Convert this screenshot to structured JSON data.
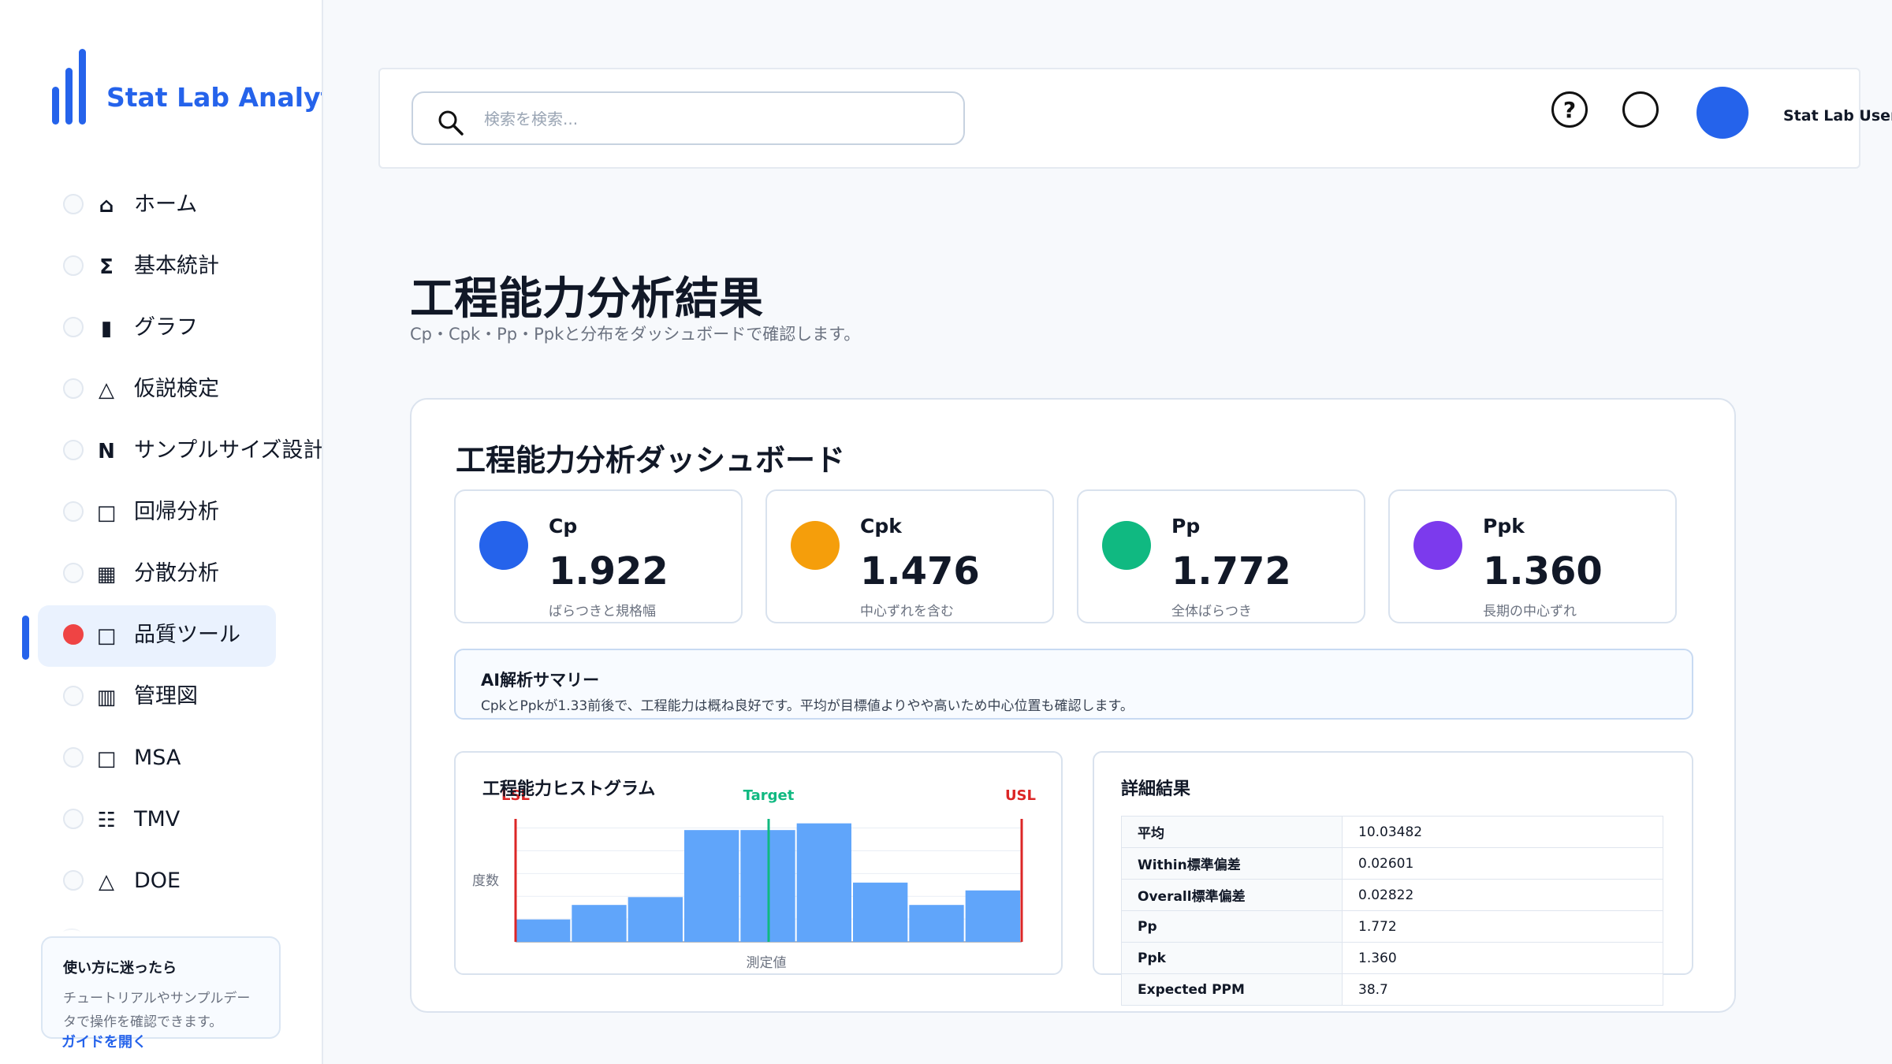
{
  "app": {
    "name": "Stat Lab Analytics"
  },
  "sidebar": {
    "items": [
      {
        "glyph": "⌂",
        "label": "ホーム",
        "icon": "home-icon",
        "active": false
      },
      {
        "glyph": "Σ",
        "label": "基本統計",
        "icon": "sigma-icon",
        "active": false
      },
      {
        "glyph": "▮",
        "label": "グラフ",
        "icon": "bar-icon",
        "active": false
      },
      {
        "glyph": "△",
        "label": "仮説検定",
        "icon": "triangle-icon",
        "active": false
      },
      {
        "glyph": "N",
        "label": "サンプルサイズ設計",
        "icon": "n-icon",
        "active": false
      },
      {
        "glyph": "□",
        "label": "回帰分析",
        "icon": "square-icon",
        "active": false
      },
      {
        "glyph": "▦",
        "label": "分散分析",
        "icon": "grid-icon",
        "active": false
      },
      {
        "glyph": "□",
        "label": "品質ツール",
        "icon": "square-icon",
        "active": true
      },
      {
        "glyph": "▥",
        "label": "管理図",
        "icon": "chart-icon",
        "active": false
      },
      {
        "glyph": "□",
        "label": "MSA",
        "icon": "square-icon",
        "active": false
      },
      {
        "glyph": "☷",
        "label": "TMV",
        "icon": "list-icon",
        "active": false
      },
      {
        "glyph": "△",
        "label": "DOE",
        "icon": "triangle-icon",
        "active": false
      }
    ],
    "help": {
      "title": "使い方に迷ったら",
      "body": "チュートリアルやサンプルデータで操作を確認できます。",
      "link": "ガイドを開く"
    }
  },
  "topbar": {
    "search_placeholder": "検索を検索...",
    "help_glyph": "?",
    "user_name": "Stat Lab User"
  },
  "page": {
    "title": "工程能力分析結果",
    "subtitle": "Cp・Cpk・Pp・Ppkと分布をダッシュボードで確認します。"
  },
  "dashboard": {
    "title": "工程能力分析ダッシュボード",
    "kpis": [
      {
        "name": "Cp",
        "value": "1.922",
        "desc": "ばらつきと規格幅",
        "color": "#2563eb"
      },
      {
        "name": "Cpk",
        "value": "1.476",
        "desc": "中心ずれを含む",
        "color": "#f59e0b"
      },
      {
        "name": "Pp",
        "value": "1.772",
        "desc": "全体ばらつき",
        "color": "#10b981"
      },
      {
        "name": "Ppk",
        "value": "1.360",
        "desc": "長期の中心ずれ",
        "color": "#7c3aed"
      }
    ],
    "ai": {
      "title": "AI解析サマリー",
      "body": "CpkとPpkが1.33前後で、工程能力は概ね良好です。平均が目標値よりやや高いため中心位置も確認します。"
    },
    "histogram_title": "工程能力ヒストグラム",
    "detail": {
      "title": "詳細結果",
      "rows": [
        {
          "key": "平均",
          "value": "10.03482"
        },
        {
          "key": "Within標準偏差",
          "value": "0.02601"
        },
        {
          "key": "Overall標準偏差",
          "value": "0.02822"
        },
        {
          "key": "Pp",
          "value": "1.772"
        },
        {
          "key": "Ppk",
          "value": "1.360"
        },
        {
          "key": "Expected PPM",
          "value": "38.7"
        }
      ]
    }
  },
  "chart_data": {
    "type": "bar",
    "title": "工程能力ヒストグラム",
    "xlabel": "測定値",
    "ylabel": "度数",
    "values": [
      2,
      3.3,
      4,
      10,
      10,
      10.6,
      5.3,
      3.3,
      4.6
    ],
    "ylim": [
      0,
      11
    ],
    "spec_lines": [
      {
        "name": "LSL",
        "position": 0.0,
        "color": "#dc2626"
      },
      {
        "name": "Target",
        "position": 0.5,
        "color": "#10b981"
      },
      {
        "name": "USL",
        "position": 1.0,
        "color": "#dc2626"
      }
    ],
    "bar_color": "#60a5fa",
    "grid": true
  }
}
